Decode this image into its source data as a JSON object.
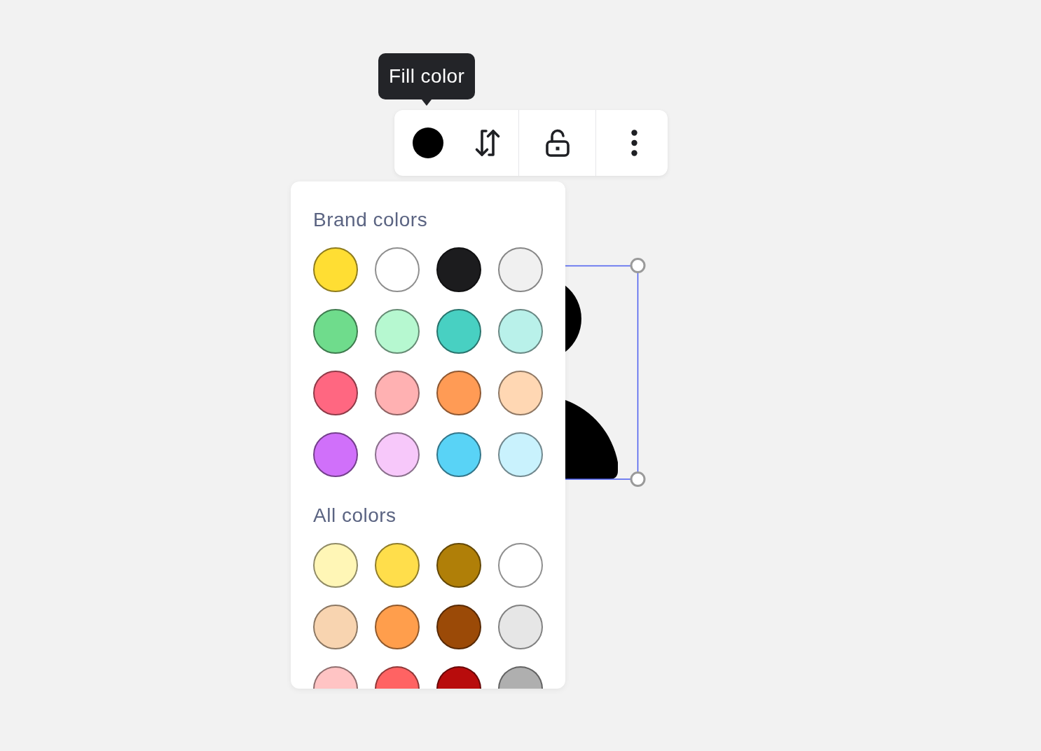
{
  "tooltip": {
    "text": "Fill color"
  },
  "toolbar": {
    "groups": [
      {
        "buttons": [
          {
            "kind": "fill",
            "color": "#000000"
          },
          {
            "kind": "swap"
          }
        ]
      },
      {
        "buttons": [
          {
            "kind": "lock"
          }
        ]
      },
      {
        "buttons": [
          {
            "kind": "more"
          }
        ]
      }
    ]
  },
  "canvas": {
    "shape": {
      "kind": "person",
      "selected": true
    }
  },
  "color_panel": {
    "sections": [
      {
        "title": "Brand colors",
        "swatches": [
          {
            "color": "#ffde33"
          },
          {
            "color": "#ffffff"
          },
          {
            "color": "#1c1c1e"
          },
          {
            "color": "#f0f0f0"
          },
          {
            "color": "#6fdc8c"
          },
          {
            "color": "#b6f8d0"
          },
          {
            "color": "#48d0c2"
          },
          {
            "color": "#b9f1ea"
          },
          {
            "color": "#ff6781"
          },
          {
            "color": "#ffb1b2"
          },
          {
            "color": "#ff9b55"
          },
          {
            "color": "#ffd7b3"
          },
          {
            "color": "#d070fa"
          },
          {
            "color": "#f7c8fa"
          },
          {
            "color": "#59d3f6"
          },
          {
            "color": "#c9f2fd"
          }
        ]
      },
      {
        "title": "All colors",
        "swatches": [
          {
            "color": "#fff6b6"
          },
          {
            "color": "#ffde4b"
          },
          {
            "color": "#b07f08"
          },
          {
            "color": "#ffffff"
          },
          {
            "color": "#f8d4b0"
          },
          {
            "color": "#ff9e4c"
          },
          {
            "color": "#9b4a07"
          },
          {
            "color": "#e6e6e6"
          },
          {
            "color": "#ffc4c4"
          },
          {
            "color": "#ff6363"
          },
          {
            "color": "#b80c0c"
          },
          {
            "color": "#afafaf"
          }
        ]
      }
    ]
  }
}
